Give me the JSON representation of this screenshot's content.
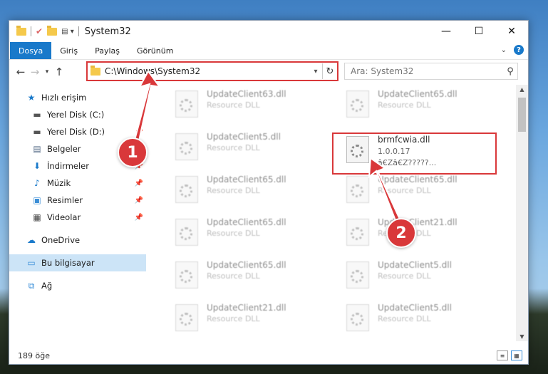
{
  "window": {
    "title": "System32"
  },
  "ribbon": {
    "tabs": [
      "Dosya",
      "Giriş",
      "Paylaş",
      "Görünüm"
    ]
  },
  "address": {
    "path": "C:\\Windows\\System32"
  },
  "search": {
    "placeholder": "Ara: System32"
  },
  "nav": {
    "items": [
      {
        "label": "Hızlı erişim",
        "icon": "star-icon"
      },
      {
        "label": "Yerel Disk (C:)",
        "icon": "drive-icon"
      },
      {
        "label": "Yerel Disk (D:)",
        "icon": "drive-icon"
      },
      {
        "label": "Belgeler",
        "icon": "documents-icon"
      },
      {
        "label": "İndirmeler",
        "icon": "download-icon"
      },
      {
        "label": "Müzik",
        "icon": "music-icon"
      },
      {
        "label": "Resimler",
        "icon": "pictures-icon"
      },
      {
        "label": "Videolar",
        "icon": "video-icon"
      },
      {
        "label": "OneDrive",
        "icon": "cloud-icon"
      },
      {
        "label": "Bu bilgisayar",
        "icon": "computer-icon"
      },
      {
        "label": "Ağ",
        "icon": "network-icon"
      }
    ]
  },
  "files": [
    {
      "name": "UpdateClient63.dll",
      "desc": "Resource DLL"
    },
    {
      "name": "UpdateClient65.dll",
      "desc": "Resource DLL"
    },
    {
      "name": "UpdateClient5.dll",
      "desc": "Resource DLL"
    },
    {
      "name": "UpdateClient65.dll",
      "desc": "Resource DLL"
    },
    {
      "name": "UpdateClient65.dll",
      "desc": "Resource DLL"
    },
    {
      "name": "UpdateClient65.dll",
      "desc": "Resource DLL"
    },
    {
      "name": "UpdateClient21.dll",
      "desc": "Resource DLL"
    },
    {
      "name": "UpdateClient65.dll",
      "desc": "Resource DLL"
    },
    {
      "name": "UpdateClient5.dll",
      "desc": "Resource DLL"
    },
    {
      "name": "UpdateClient21.dll",
      "desc": "Resource DLL"
    },
    {
      "name": "UpdateClient5.dll",
      "desc": "Resource DLL"
    }
  ],
  "focused_file": {
    "name": "brmfcwia.dll",
    "version": "1.0.0.17",
    "desc": "â€Zâ€Z?????..."
  },
  "status": {
    "count": "189 öğe"
  },
  "markers": {
    "one": "1",
    "two": "2"
  },
  "colors": {
    "accent": "#1979ca",
    "highlight": "#d9383a"
  }
}
